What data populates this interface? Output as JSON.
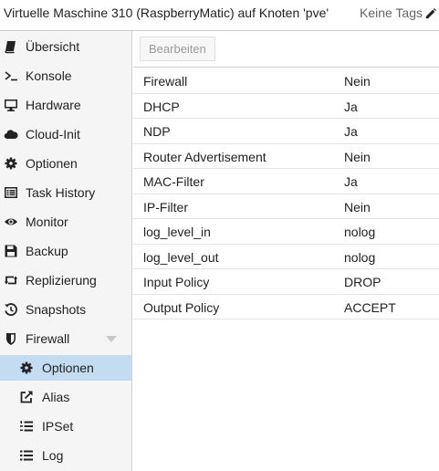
{
  "header": {
    "title": "Virtuelle Maschine 310 (RaspberryMatic) auf Knoten 'pve'",
    "tags_label": "Keine Tags",
    "edit_icon": "pencil-icon"
  },
  "sidebar": {
    "items": [
      {
        "label": "Übersicht",
        "icon": "book-icon"
      },
      {
        "label": "Konsole",
        "icon": "terminal-icon"
      },
      {
        "label": "Hardware",
        "icon": "desktop-icon"
      },
      {
        "label": "Cloud-Init",
        "icon": "cloud-icon"
      },
      {
        "label": "Optionen",
        "icon": "gear-icon"
      },
      {
        "label": "Task History",
        "icon": "list-alt-icon"
      },
      {
        "label": "Monitor",
        "icon": "eye-icon"
      },
      {
        "label": "Backup",
        "icon": "floppy-icon"
      },
      {
        "label": "Replizierung",
        "icon": "retweet-icon"
      },
      {
        "label": "Snapshots",
        "icon": "history-icon"
      },
      {
        "label": "Firewall",
        "icon": "shield-icon",
        "expanded": true
      }
    ],
    "subitems": [
      {
        "label": "Optionen",
        "icon": "gear-icon",
        "selected": true
      },
      {
        "label": "Alias",
        "icon": "external-link-icon"
      },
      {
        "label": "IPSet",
        "icon": "list-ol-icon"
      },
      {
        "label": "Log",
        "icon": "list-icon"
      }
    ]
  },
  "toolbar": {
    "edit_label": "Bearbeiten"
  },
  "grid": {
    "rows": [
      {
        "name": "Firewall",
        "value": "Nein"
      },
      {
        "name": "DHCP",
        "value": "Ja"
      },
      {
        "name": "NDP",
        "value": "Ja"
      },
      {
        "name": "Router Advertisement",
        "value": "Nein"
      },
      {
        "name": "MAC-Filter",
        "value": "Ja"
      },
      {
        "name": "IP-Filter",
        "value": "Nein"
      },
      {
        "name": "log_level_in",
        "value": "nolog"
      },
      {
        "name": "log_level_out",
        "value": "nolog"
      },
      {
        "name": "Input Policy",
        "value": "DROP"
      },
      {
        "name": "Output Policy",
        "value": "ACCEPT"
      }
    ]
  },
  "colors": {
    "selected_bg": "#c4dcf2",
    "sidebar_bg": "#f5f5f5",
    "border": "#d0d0d0"
  }
}
